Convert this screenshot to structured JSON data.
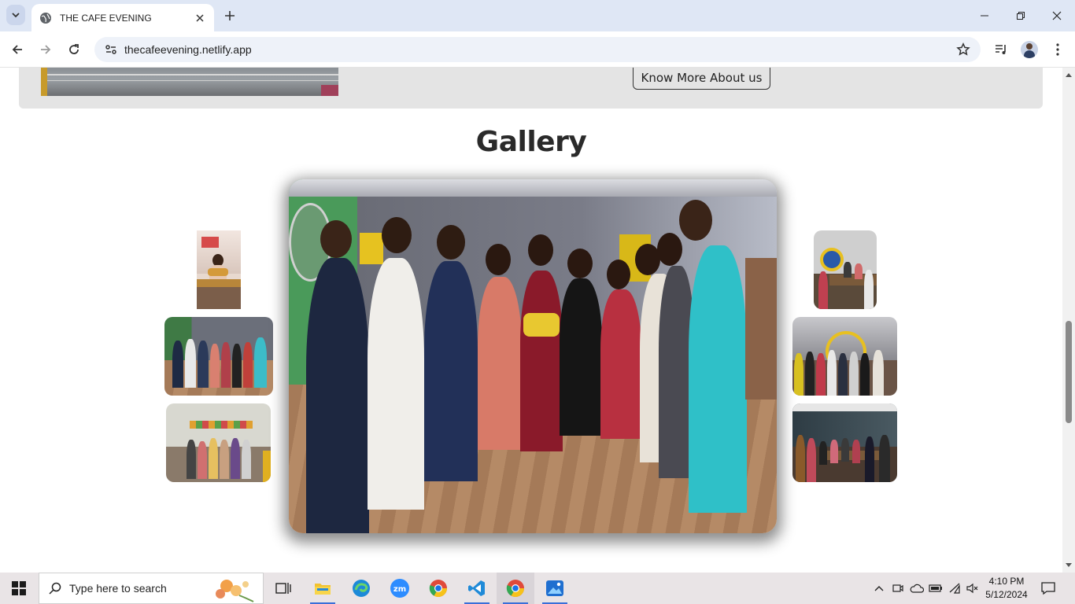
{
  "browser": {
    "tab_title": "THE CAFE EVENING",
    "url": "thecafeevening.netlify.app"
  },
  "page": {
    "know_more_label": "Know More About us",
    "gallery_title": "Gallery"
  },
  "taskbar": {
    "search_placeholder": "Type here to search",
    "time": "4:10 PM",
    "date": "5/12/2024"
  }
}
